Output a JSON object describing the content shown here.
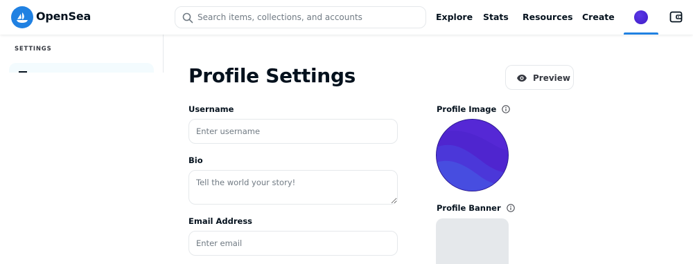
{
  "header": {
    "brand": "OpenSea",
    "search_placeholder": "Search items, collections, and accounts",
    "nav": {
      "explore": "Explore",
      "stats": "Stats",
      "resources": "Resources",
      "create": "Create"
    },
    "icons": {
      "logo": "opensea-logo-icon",
      "search": "search-icon",
      "avatar": "account-avatar-icon",
      "wallet": "wallet-icon"
    }
  },
  "sidebar": {
    "title": "SETTINGS",
    "items": [
      {
        "icon": "menu-icon",
        "active": true
      }
    ]
  },
  "main": {
    "title": "Profile Settings",
    "preview_label": "Preview",
    "fields": {
      "username": {
        "label": "Username",
        "placeholder": "Enter username",
        "value": ""
      },
      "bio": {
        "label": "Bio",
        "placeholder": "Tell the world your story!",
        "value": ""
      },
      "email": {
        "label": "Email Address",
        "placeholder": "Enter email",
        "value": ""
      }
    },
    "profile_image_label": "Profile Image",
    "profile_banner_label": "Profile Banner"
  },
  "colors": {
    "brand_blue": "#2081e2",
    "text_primary": "#04111d",
    "border": "#e5e8eb",
    "placeholder": "#707a83",
    "avatar_purple": "#5227d4",
    "banner_gray": "#e5e8eb",
    "sidebar_active_bg": "#f3fbfe"
  }
}
